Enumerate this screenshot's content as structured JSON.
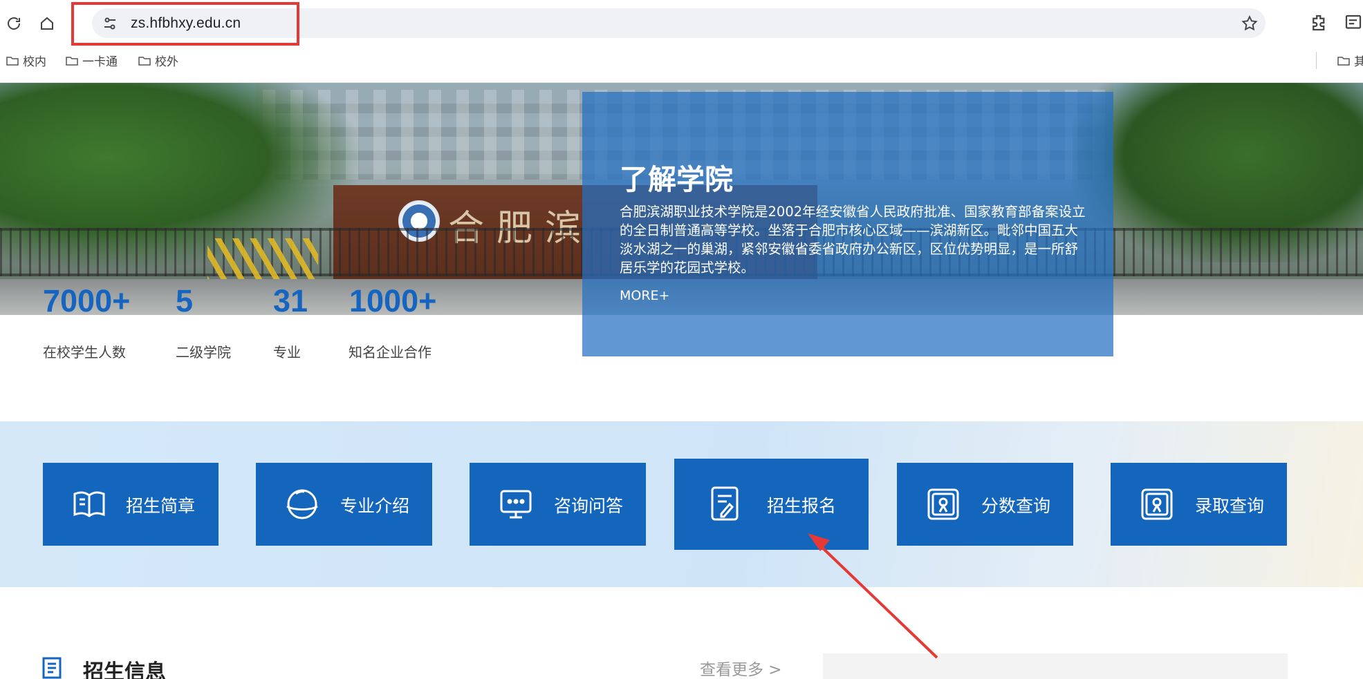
{
  "browser": {
    "url": "zs.hfbhxy.edu.cn",
    "bookmarks": [
      "校内",
      "一卡通",
      "校外"
    ],
    "bookmarks_right_partial": "其",
    "icons": [
      "reload-icon",
      "home-icon",
      "site-settings-icon",
      "star-icon",
      "extensions-icon",
      "reading-list-icon",
      "folder-icon"
    ]
  },
  "hero": {
    "gate_text": "合肥滨",
    "intro": {
      "title": "了解学院",
      "description": "合肥滨湖职业技术学院是2002年经安徽省人民政府批准、国家教育部备案设立的全日制普通高等学校。坐落于合肥市核心区域——滨湖新区。毗邻中国五大淡水湖之一的巢湖，紧邻安徽省委省政府办公新区，区位优势明显，是一所舒居乐学的花园式学校。",
      "more": "MORE+"
    },
    "stats": [
      {
        "value": "7000+",
        "label": "在校学生人数"
      },
      {
        "value": "5",
        "label": "二级学院"
      },
      {
        "value": "31",
        "label": "专业"
      },
      {
        "value": "1000+",
        "label": "知名企业合作"
      }
    ]
  },
  "quick_links": [
    {
      "label": "招生简章",
      "icon": "brochure-icon"
    },
    {
      "label": "专业介绍",
      "icon": "globe-icon"
    },
    {
      "label": "咨询问答",
      "icon": "chat-icon"
    },
    {
      "label": "招生报名",
      "icon": "form-icon"
    },
    {
      "label": "分数查询",
      "icon": "certificate-icon"
    },
    {
      "label": "录取查询",
      "icon": "certificate-icon"
    }
  ],
  "news": {
    "title": "招生信息",
    "more": "查看更多 >"
  },
  "colors": {
    "primary_blue": "#1466bd",
    "annotation_red": "#e53935",
    "stat_blue": "#1565c0"
  }
}
